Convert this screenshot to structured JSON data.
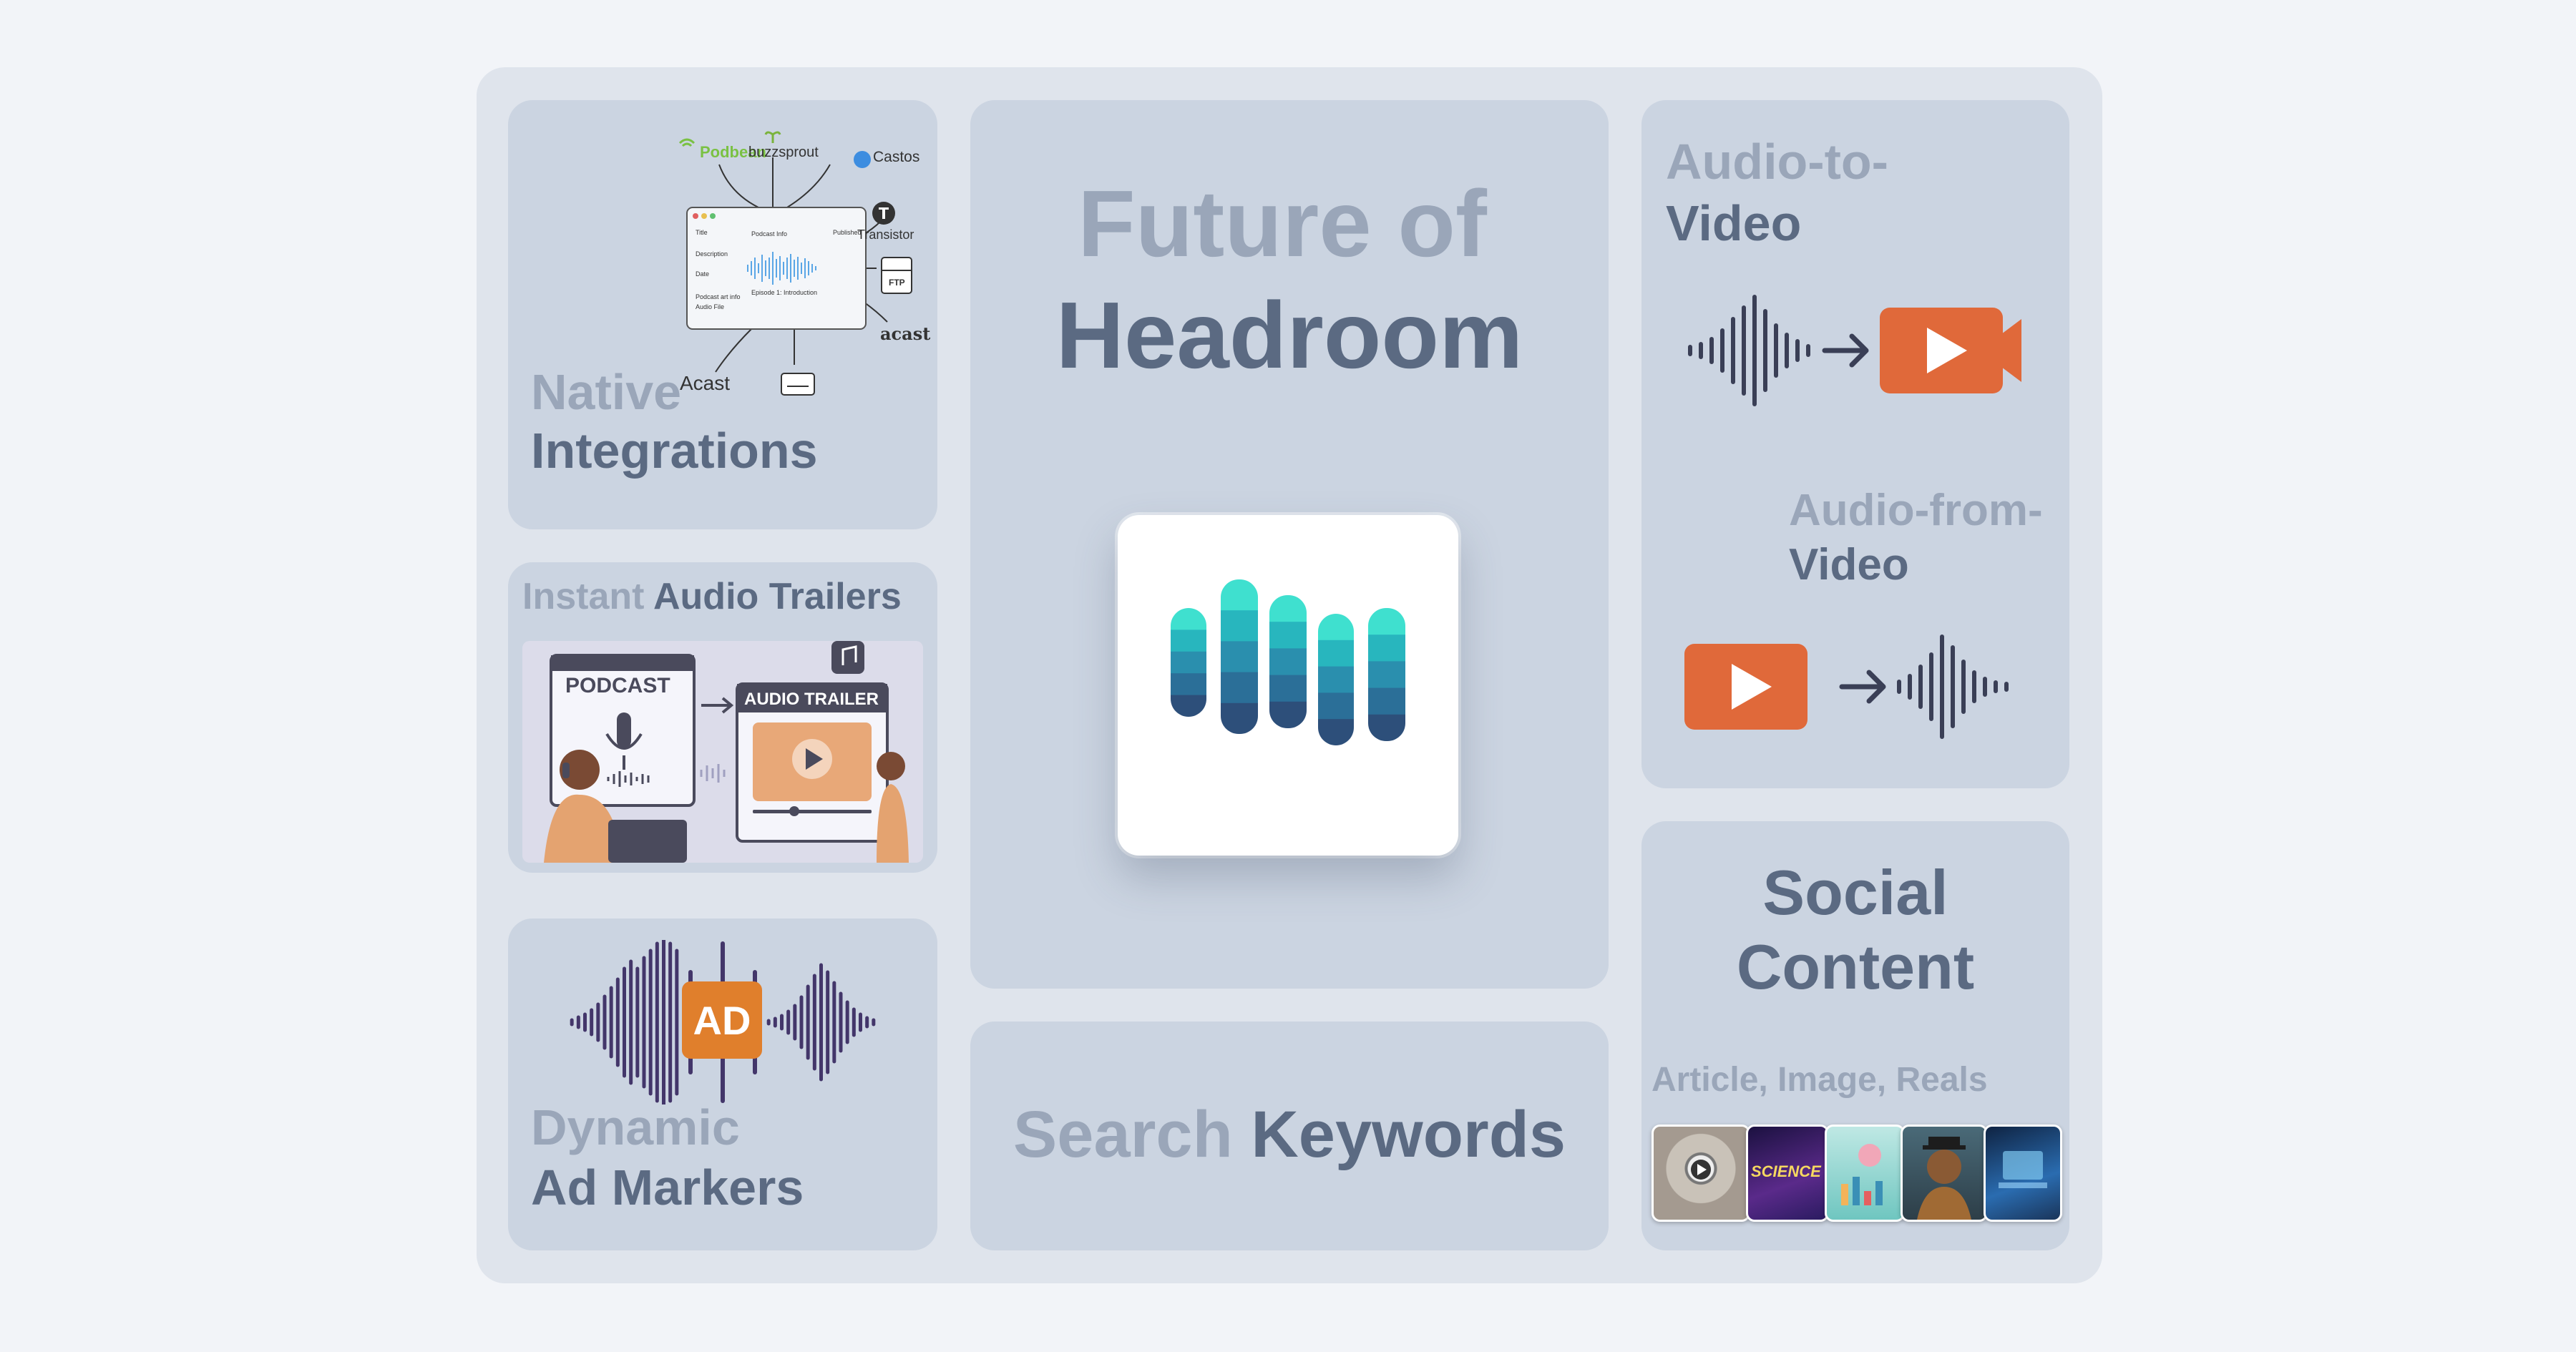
{
  "hero": {
    "title_line1": "Future of",
    "title_line2": "Headroom",
    "logo_colors": [
      "#3fe0cf",
      "#28b6be",
      "#2a8fae",
      "#2b6f98",
      "#2d4f7a"
    ]
  },
  "native": {
    "title_light": "Native",
    "title_dark": "Integrations",
    "logos": {
      "podbean": "Podbean",
      "buzzsprout": "buzzsprout",
      "castos": "Castos",
      "transistor": "Transistor",
      "ftp": "FTP",
      "acast_right": "acast",
      "acast_bottom": "Acast"
    },
    "form": {
      "title_label": "Title",
      "podcast_info": "Podcast Info",
      "published": "Published",
      "description": "Description",
      "date": "Date",
      "episode": "Episode 1: Introduction",
      "podcast_art": "Podcast art info",
      "audio_file": "Audio File"
    }
  },
  "trailers": {
    "title_light": "Instant",
    "title_dark": "Audio Trailers",
    "podcast_label": "PODCAST",
    "trailer_label": "AUDIO TRAILER"
  },
  "ad": {
    "badge": "AD",
    "title_light": "Dynamic",
    "title_dark": "Ad Markers",
    "badge_color": "#e07f2c"
  },
  "search": {
    "light": "Search",
    "dark": "Keywords"
  },
  "video": {
    "a2v_light": "Audio-to-",
    "a2v_dark": "Video",
    "afv_light": "Audio-from-",
    "afv_dark": "Video",
    "accent": "#e0693a"
  },
  "social": {
    "line1": "Social",
    "line2": "Content",
    "subtitle": "Article, Image, Reals",
    "thumb5_text": "SCIENCE"
  }
}
